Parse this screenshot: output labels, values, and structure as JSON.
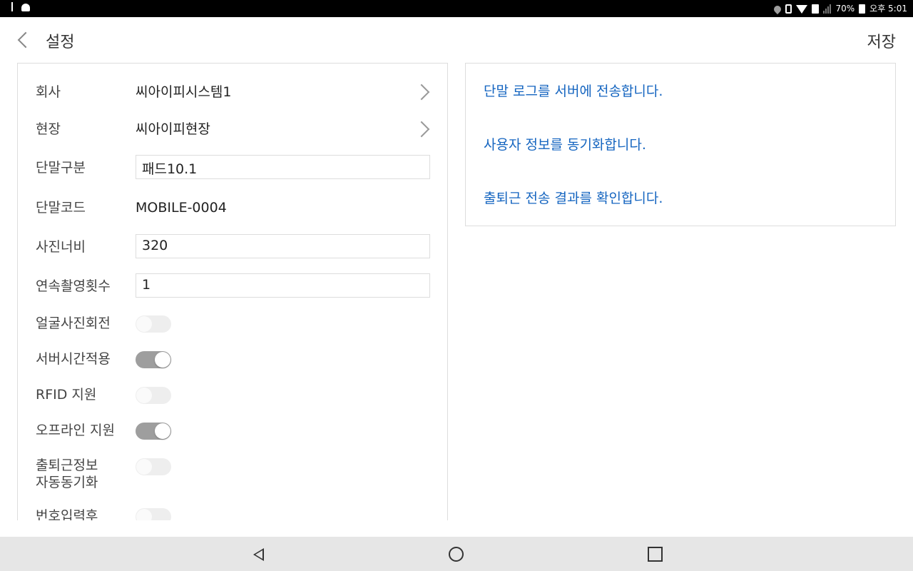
{
  "status_bar": {
    "left_icons": [
      "usb-icon",
      "android-debug-icon"
    ],
    "right_icons": [
      "location-icon",
      "vibrate-icon",
      "wifi-icon",
      "sim-icon",
      "signal-icon",
      "battery-icon"
    ],
    "battery_percent": "70%",
    "time": "오후 5:01"
  },
  "app_bar": {
    "back_icon": "chevron-left-icon",
    "title": "설정",
    "save_label": "저장"
  },
  "settings": {
    "company": {
      "label": "회사",
      "value": "씨아이피시스템1"
    },
    "site": {
      "label": "현장",
      "value": "씨아이피현장"
    },
    "device_type": {
      "label": "단말구분",
      "value": "패드10.1"
    },
    "device_code": {
      "label": "단말코드",
      "value": "MOBILE-0004"
    },
    "photo_width": {
      "label": "사진너비",
      "value": "320"
    },
    "burst_count": {
      "label": "연속촬영횟수",
      "value": "1"
    },
    "toggles": [
      {
        "label": "얼굴사진회전",
        "on": false
      },
      {
        "label": "서버시간적용",
        "on": true
      },
      {
        "label": "RFID 지원",
        "on": false
      },
      {
        "label": "오프라인 지원",
        "on": true
      },
      {
        "label_line1": "출퇴근정보",
        "label_line2": "자동동기화",
        "on": false
      },
      {
        "label": "번호입력후",
        "on": false
      }
    ]
  },
  "actions": [
    {
      "label": "단말 로그를 서버에 전송합니다."
    },
    {
      "label": "사용자 정보를 동기화합니다."
    },
    {
      "label": "출퇴근 전송 결과를 확인합니다."
    }
  ],
  "colors": {
    "link": "#1565c0",
    "toggle_on": "#9e9e9e",
    "toggle_off": "#eeeeee",
    "navbar_bg": "#e6e6e6"
  },
  "nav_bar": {
    "buttons": [
      "back-triangle-icon",
      "home-circle-icon",
      "recents-square-icon"
    ]
  }
}
